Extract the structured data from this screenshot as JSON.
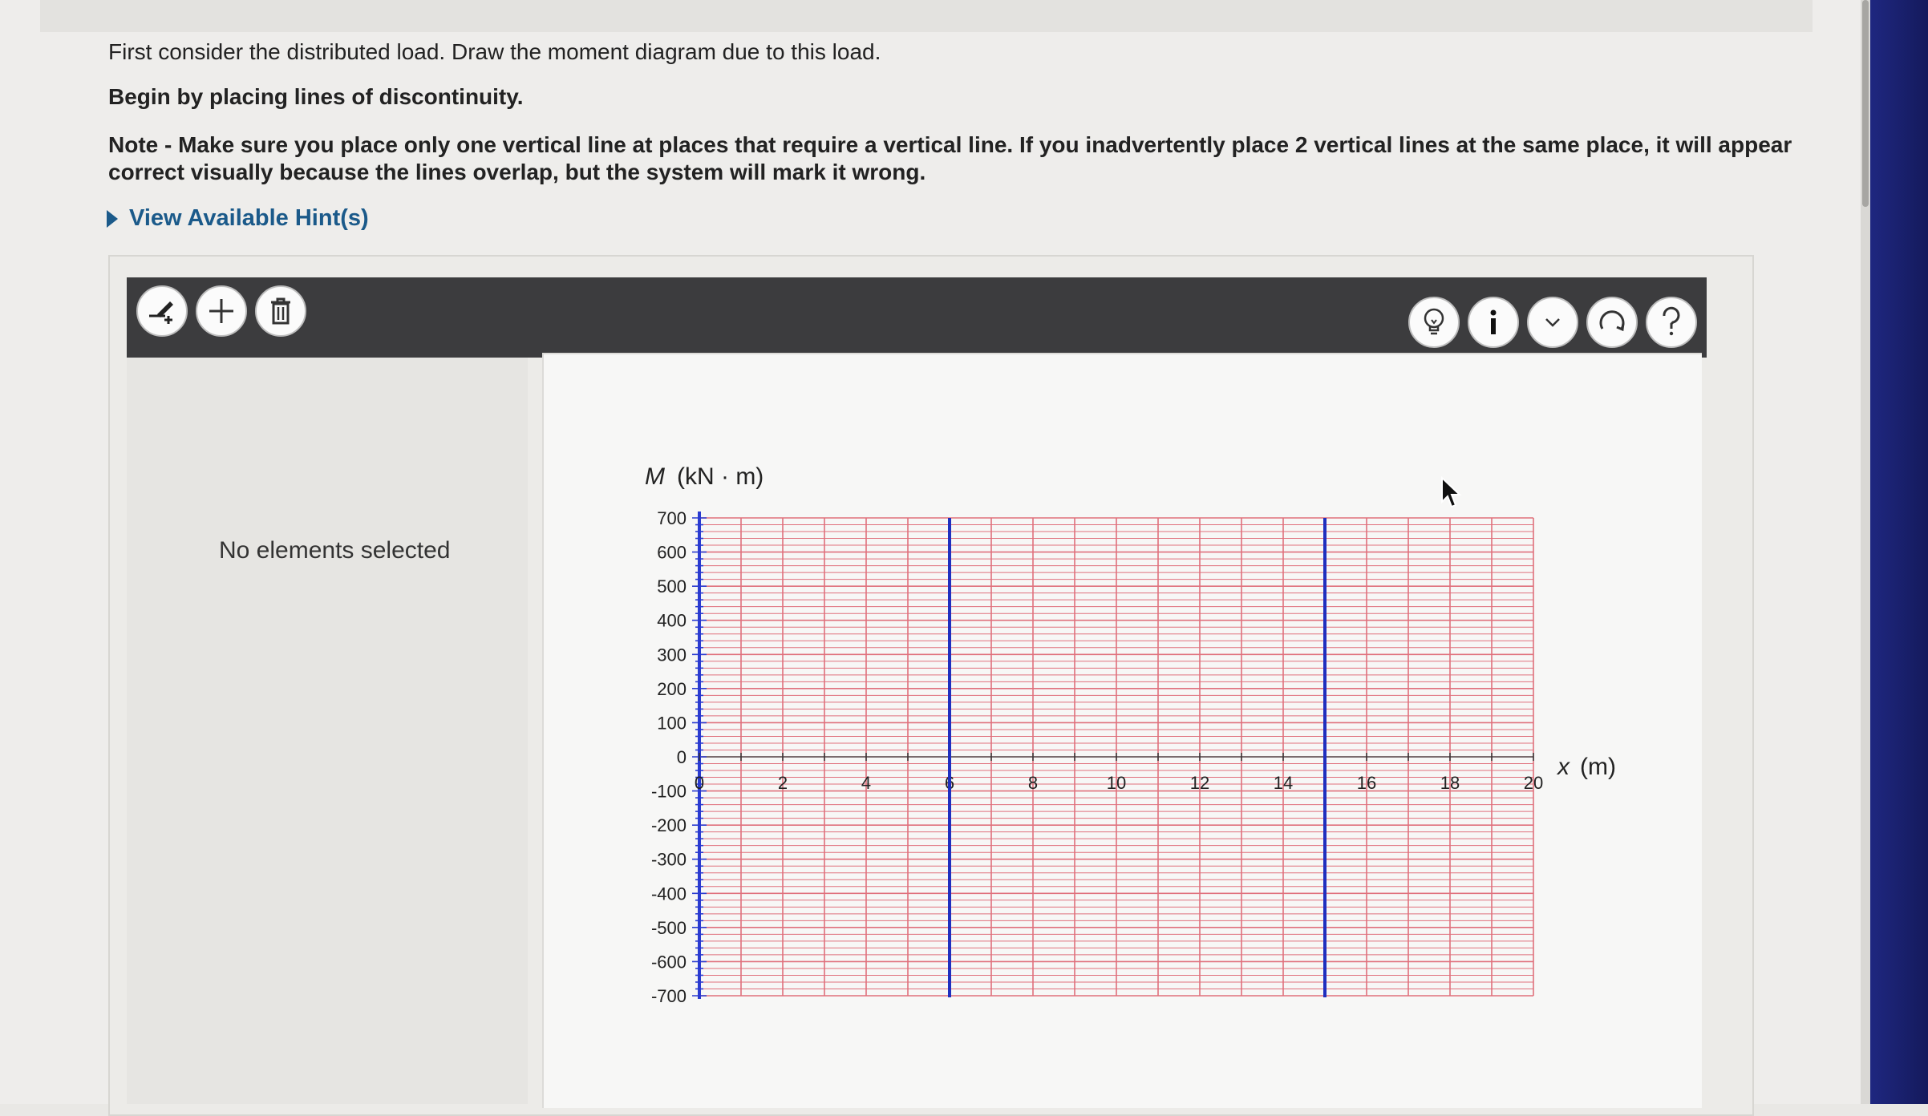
{
  "instructions": {
    "line1": "First consider the distributed load. Draw the moment diagram due to this load.",
    "line2": "Begin by placing lines of discontinuity.",
    "note_line1": "Note - Make sure you place only one vertical line at places that require a vertical line. If you inadvertently place 2 vertical lines at the same place, it will appear",
    "note_line2": "correct visually because the lines overlap, but the system will mark it wrong."
  },
  "hints": {
    "label": "View Available Hint(s)"
  },
  "toolbar": {
    "left_icons": [
      "draw-line-icon",
      "plus-icon",
      "trash-icon"
    ],
    "right_icons": [
      "lightbulb-icon",
      "info-icon",
      "chevron-down-icon",
      "reset-icon",
      "help-icon"
    ]
  },
  "panel": {
    "no_selection": "No elements selected"
  },
  "graph": {
    "y_label_var": "M",
    "y_label_unit": "(kN · m)",
    "x_label_var": "x",
    "x_label_unit": "(m)",
    "x_range": [
      0,
      20
    ],
    "y_range": [
      -700,
      700
    ],
    "x_ticks": [
      "0",
      "2",
      "4",
      "6",
      "8",
      "10",
      "12",
      "14",
      "16",
      "18",
      "20"
    ],
    "y_ticks": [
      "700",
      "600",
      "500",
      "400",
      "300",
      "200",
      "100",
      "0",
      "-100",
      "-200",
      "-300",
      "-400",
      "-500",
      "-600",
      "-700"
    ],
    "vertical_lines_x": [
      6,
      15
    ],
    "grid_color": "#e0707c",
    "line_color": "#1f2fbf"
  }
}
